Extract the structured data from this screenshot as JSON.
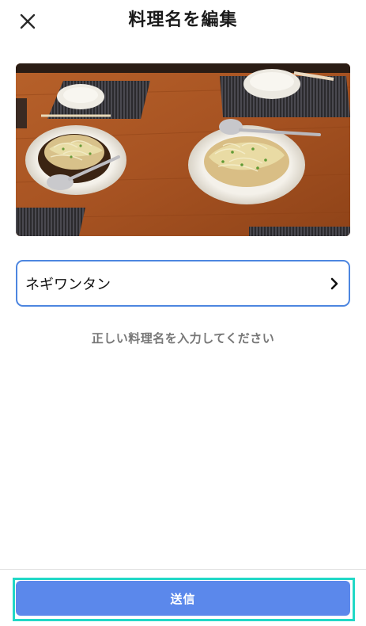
{
  "header": {
    "title": "料理名を編集",
    "close_icon": "close-icon"
  },
  "photo": {
    "subject": "two plates of dumplings with sliced green onions on a wooden table"
  },
  "dish_name_field": {
    "value": "ネギワンタン",
    "trailing_icon": "chevron-right-icon"
  },
  "hint_text": "正しい料理名を入力してください",
  "footer": {
    "submit_label": "送信"
  },
  "colors": {
    "accent_blue": "#5b88eb",
    "field_border": "#4d86e0",
    "focus_outline": "#21d8c6",
    "hint_gray": "#777777"
  }
}
